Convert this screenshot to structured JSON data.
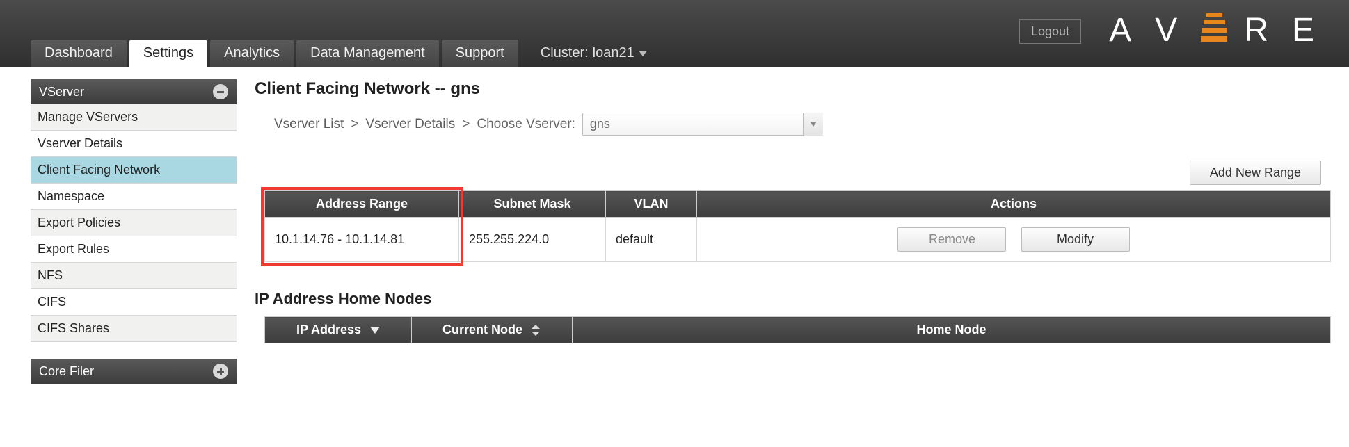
{
  "header": {
    "logout_label": "Logout",
    "logo_letters": [
      "A",
      "V",
      "R",
      "E"
    ]
  },
  "nav": {
    "tabs": [
      {
        "label": "Dashboard",
        "active": false
      },
      {
        "label": "Settings",
        "active": true
      },
      {
        "label": "Analytics",
        "active": false
      },
      {
        "label": "Data Management",
        "active": false
      },
      {
        "label": "Support",
        "active": false
      }
    ],
    "cluster_prefix": "Cluster:",
    "cluster_name": "loan21"
  },
  "sidebar": {
    "groups": [
      {
        "title": "VServer",
        "collapsed": false,
        "items": [
          {
            "label": "Manage VServers",
            "active": false
          },
          {
            "label": "Vserver Details",
            "active": false
          },
          {
            "label": "Client Facing Network",
            "active": true
          },
          {
            "label": "Namespace",
            "active": false
          },
          {
            "label": "Export Policies",
            "active": false
          },
          {
            "label": "Export Rules",
            "active": false
          },
          {
            "label": "NFS",
            "active": false
          },
          {
            "label": "CIFS",
            "active": false
          },
          {
            "label": "CIFS Shares",
            "active": false
          }
        ]
      },
      {
        "title": "Core Filer",
        "collapsed": true,
        "items": []
      }
    ]
  },
  "main": {
    "page_title": "Client Facing Network -- gns",
    "breadcrumb": {
      "link1": "Vserver List",
      "link2": "Vserver Details",
      "choose_label": "Choose Vserver:",
      "selected_vserver": "gns"
    },
    "add_range_label": "Add New Range",
    "ranges_table": {
      "headers": [
        "Address Range",
        "Subnet Mask",
        "VLAN",
        "Actions"
      ],
      "rows": [
        {
          "address_range": "10.1.14.76 - 10.1.14.81",
          "subnet_mask": "255.255.224.0",
          "vlan": "default",
          "remove_label": "Remove",
          "modify_label": "Modify"
        }
      ]
    },
    "home_nodes_title": "IP Address Home Nodes",
    "home_table": {
      "headers": [
        "IP Address",
        "Current Node",
        "Home Node"
      ]
    }
  }
}
